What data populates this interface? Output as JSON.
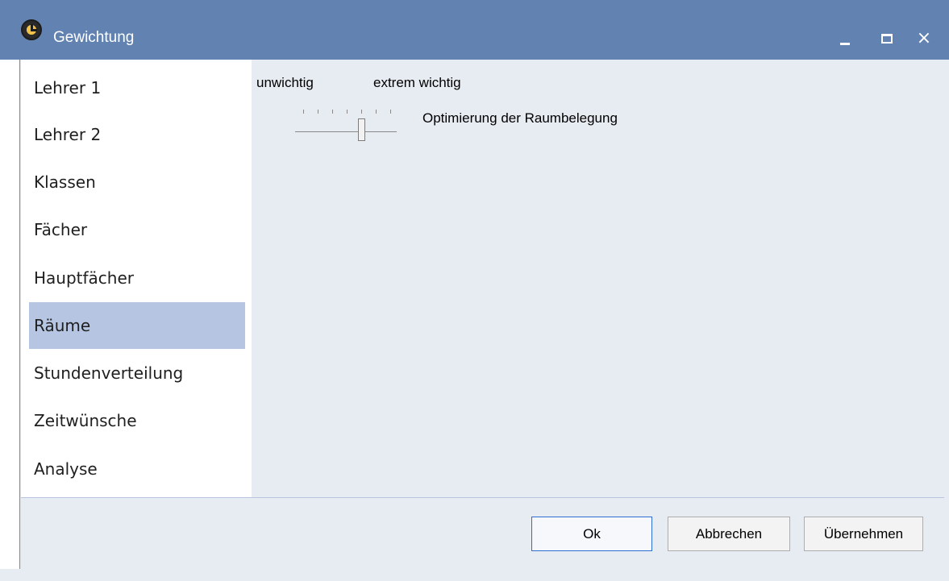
{
  "window": {
    "title": "Gewichtung",
    "controls": {
      "minimize": "minimize",
      "maximize": "maximize",
      "close": "×"
    },
    "icon": "clock-icon"
  },
  "sidebar": {
    "items": [
      {
        "label": "Lehrer 1",
        "selected": false
      },
      {
        "label": "Lehrer 2",
        "selected": false
      },
      {
        "label": "Klassen",
        "selected": false
      },
      {
        "label": "Fächer",
        "selected": false
      },
      {
        "label": "Hauptfächer",
        "selected": false
      },
      {
        "label": "Räume",
        "selected": true
      },
      {
        "label": "Stundenverteilung",
        "selected": false
      },
      {
        "label": "Zeitwünsche",
        "selected": false
      },
      {
        "label": "Analyse",
        "selected": false
      }
    ],
    "selected_color": "#b6c6e2"
  },
  "main": {
    "scale_low_label": "unwichtig",
    "scale_high_label": "extrem wichtig",
    "sliders": [
      {
        "label": "Optimierung der Raumbelegung",
        "min": 0,
        "max": 6,
        "value": 4
      }
    ]
  },
  "footer": {
    "ok_label": "Ok",
    "cancel_label": "Abbrechen",
    "apply_label": "Übernehmen"
  },
  "colors": {
    "titlebar": "#6283b2",
    "focus_border": "#2f6ed1"
  }
}
